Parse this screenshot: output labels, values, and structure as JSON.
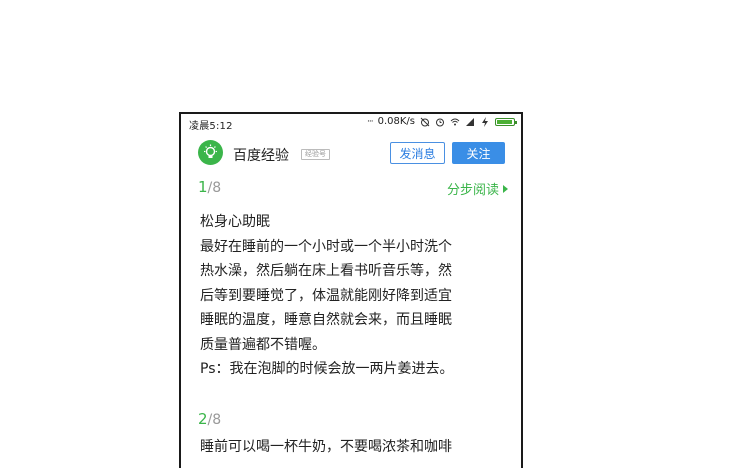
{
  "status_bar": {
    "time": "凌晨5:12",
    "network_speed": "0.08K/s"
  },
  "header": {
    "brand": "百度经验",
    "badge": "经验号",
    "message_button": "发消息",
    "follow_button": "关注"
  },
  "steps": [
    {
      "current": "1",
      "total": "/8",
      "link_label": "分步阅读",
      "lines": [
        "松身心助眠",
        "最好在睡前的一个小时或一个半小时洗个",
        "热水澡，然后躺在床上看书听音乐等，然",
        "后等到要睡觉了，体温就能刚好降到适宜",
        "睡眠的温度，睡意自然就会来，而且睡眠",
        "质量普遍都不错喔。",
        "Ps：我在泡脚的时候会放一两片姜进去。"
      ]
    },
    {
      "current": "2",
      "total": "/8",
      "lines": [
        "睡前可以喝一杯牛奶，不要喝浓茶和咖啡"
      ]
    }
  ],
  "colors": {
    "accent_green": "#3bb54a",
    "accent_blue": "#3a8ee6"
  }
}
